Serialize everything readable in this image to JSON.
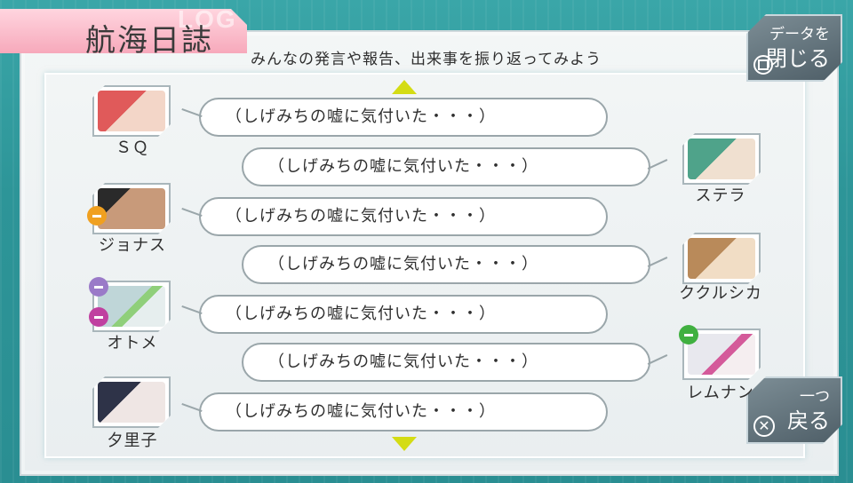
{
  "header": {
    "title": "航海日誌",
    "title_ghost": "LOG",
    "subtitle": "みんなの発言や報告、出来事を振り返ってみよう"
  },
  "buttons": {
    "close": {
      "line1": "データを",
      "line2": "閉じる",
      "icon": "square-button-icon"
    },
    "back": {
      "line1": "一つ",
      "line2": "戻る",
      "icon": "cross-button-icon"
    }
  },
  "log": [
    {
      "speaker": "ＳＱ",
      "side": "left",
      "text": "（しげみちの嘘に気付いた・・・）",
      "face": "#e05a5a"
    },
    {
      "speaker": "ステラ",
      "side": "right",
      "text": "（しげみちの嘘に気付いた・・・）",
      "face": "#4fa38a"
    },
    {
      "speaker": "ジョナス",
      "side": "left",
      "text": "（しげみちの嘘に気付いた・・・）",
      "face": "#6b5a4a"
    },
    {
      "speaker": "ククルシカ",
      "side": "right",
      "text": "（しげみちの嘘に気付いた・・・）",
      "face": "#b98a5a"
    },
    {
      "speaker": "オトメ",
      "side": "left",
      "text": "（しげみちの嘘に気付いた・・・）",
      "face": "#bfd6d8"
    },
    {
      "speaker": "レムナン",
      "side": "right",
      "text": "（しげみちの嘘に気付いた・・・）",
      "face": "#e8e8ee"
    },
    {
      "speaker": "夕里子",
      "side": "left",
      "text": "（しげみちの嘘に気付いた・・・）",
      "face": "#2e3348"
    }
  ],
  "colors": {
    "accent_pink": "#f7a9bb",
    "arrow_yellow": "#d4dc14",
    "background_teal": "#2d9598"
  }
}
